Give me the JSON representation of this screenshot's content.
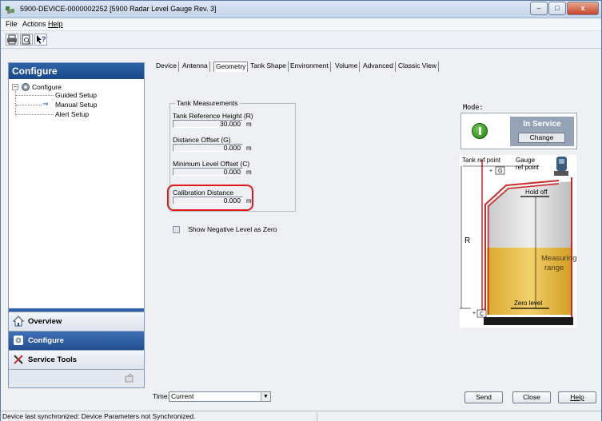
{
  "window": {
    "title": "5900-DEVICE-0000002252 [5900 Radar Level Gauge Rev. 3]",
    "controls": {
      "minimize": "–",
      "maximize": "□",
      "close": "x"
    }
  },
  "menu": [
    "File",
    "Actions",
    "Help"
  ],
  "toolbar": {
    "icons": [
      "print-icon",
      "print-preview-icon",
      "context-help-icon"
    ]
  },
  "sidebar": {
    "header": "Configure",
    "tree": {
      "root": "Configure",
      "items": [
        "Guided Setup",
        "Manual Setup",
        "Alert Setup"
      ],
      "selected": "Manual Setup"
    },
    "nav": [
      {
        "label": "Overview",
        "icon": "home-icon",
        "active": false
      },
      {
        "label": "Configure",
        "icon": "configure-icon",
        "active": true
      },
      {
        "label": "Service Tools",
        "icon": "tools-icon",
        "active": false
      }
    ]
  },
  "tabs": [
    "Device",
    "Antenna",
    "Geometry",
    "Tank Shape",
    "Environment",
    "Volume",
    "Advanced",
    "Classic View"
  ],
  "active_tab": "Geometry",
  "tank_measurements": {
    "title": "Tank Measurements",
    "fields": [
      {
        "label": "Tank Reference Height (R)",
        "value": "30.000",
        "unit": "m"
      },
      {
        "label": "Distance Offset (G)",
        "value": "0.000",
        "unit": "m"
      },
      {
        "label": "Minimum Level Offset (C)",
        "value": "0.000",
        "unit": "m"
      },
      {
        "label": "Calibration Distance",
        "value": "0.000",
        "unit": "m"
      }
    ]
  },
  "show_negative": {
    "label": "Show Negative Level as Zero",
    "checked": false
  },
  "mode": {
    "label": "Mode:",
    "status": "In Service",
    "change_label": "Change"
  },
  "diagram": {
    "tank_ref_point": "Tank ref point",
    "gauge_ref_point_1": "Gauge",
    "gauge_ref_point_2": "ref point",
    "g": "G",
    "hold_off": "Hold off",
    "r": "R",
    "measuring_1": "Measuring",
    "measuring_2": "range",
    "zero_level": "Zero level",
    "c": "C",
    "plus_g": "+",
    "plus_c": "+"
  },
  "bottom": {
    "time_label": "Time:",
    "time_value": "Current",
    "send": "Send",
    "close": "Close",
    "help": "Help"
  },
  "status": "Device last synchronized: Device Parameters not Synchronized.",
  "colors": {
    "header_blue": "#18488a",
    "highlight_red": "#e01a1a",
    "liquid": "#e5b83a",
    "tank_wall": "#cc2a2a"
  }
}
